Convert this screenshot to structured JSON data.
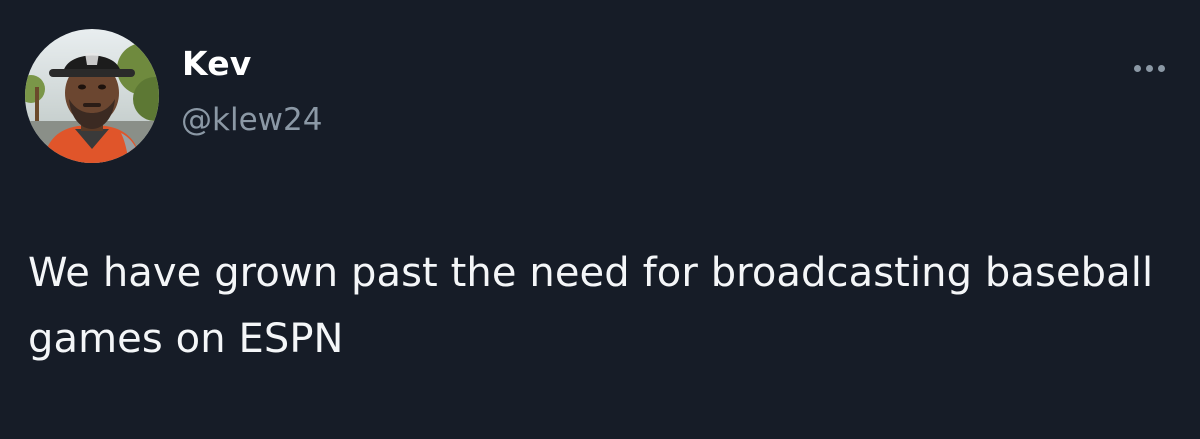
{
  "author": {
    "display_name": "Kev",
    "handle": "@klew24",
    "avatar_icon": "profile-photo"
  },
  "actions": {
    "more_icon": "more-horizontal-icon"
  },
  "tweet": {
    "text": "We have grown past the need for broadcasting baseball games on ESPN"
  },
  "colors": {
    "background": "#161c27",
    "text": "#ffffff",
    "secondary_text": "#8b98a5"
  }
}
